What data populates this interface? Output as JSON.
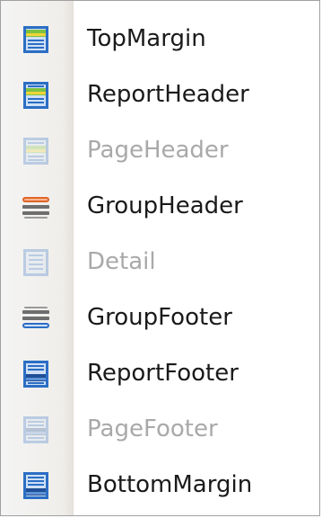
{
  "menu": {
    "items": [
      {
        "label": "TopMargin",
        "icon": "top-margin-band-icon",
        "enabled": true
      },
      {
        "label": "ReportHeader",
        "icon": "report-header-band-icon",
        "enabled": true
      },
      {
        "label": "PageHeader",
        "icon": "page-header-band-icon",
        "enabled": false
      },
      {
        "label": "GroupHeader",
        "icon": "group-header-band-icon",
        "enabled": true
      },
      {
        "label": "Detail",
        "icon": "detail-band-icon",
        "enabled": false
      },
      {
        "label": "GroupFooter",
        "icon": "group-footer-band-icon",
        "enabled": true
      },
      {
        "label": "ReportFooter",
        "icon": "report-footer-band-icon",
        "enabled": true
      },
      {
        "label": "PageFooter",
        "icon": "page-footer-band-icon",
        "enabled": false
      },
      {
        "label": "BottomMargin",
        "icon": "bottom-margin-band-icon",
        "enabled": true
      }
    ]
  },
  "colors": {
    "blue": "#2b6ec4",
    "blue_dark": "#1f4f96",
    "blue_light": "#cfe0f6",
    "green": "#7cc242",
    "yellow": "#f0d43a",
    "orange": "#e0652a",
    "gray": "#6e6e6e",
    "disabled_text": "#a9a9a9"
  }
}
